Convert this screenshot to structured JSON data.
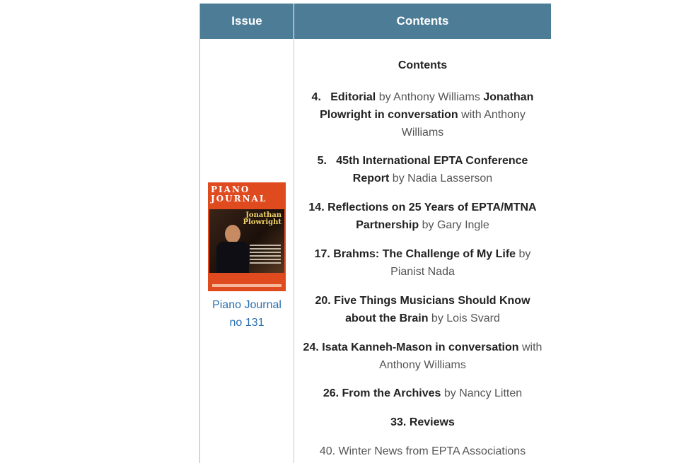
{
  "table": {
    "header_issue": "Issue",
    "header_contents": "Contents"
  },
  "issue": {
    "cover_title_line1": "PIANO",
    "cover_title_line2": "JOURNAL",
    "cover_logo": "epta",
    "cover_name_line1": "Jonathan",
    "cover_name_line2": "Plowright",
    "link_line1": "Piano Journal",
    "link_line2": "no 131"
  },
  "contents": {
    "heading": "Contents",
    "entries": [
      {
        "num": "4.",
        "title": "Editorial",
        "by": " by Anthony Williams ",
        "title2": "Jonathan Plowright in conversation",
        "by2": " with Anthony Williams"
      },
      {
        "num": "5.",
        "title": "45th International EPTA Conference Report",
        "by": " by Nadia Lasserson"
      },
      {
        "num": "14.",
        "title": "Reflections on 25 Years of EPTA/MTNA Partnership",
        "by": " by Gary Ingle"
      },
      {
        "num": "17.",
        "title": "Brahms: The Challenge of My Life",
        "by": " by Pianist Nada"
      },
      {
        "num": "20.",
        "title": "Five Things Musicians Should Know about the Brain",
        "by": " by Lois Svard"
      },
      {
        "num": "24.",
        "title": "Isata Kanneh-Mason in conversation",
        "by": " with Anthony Williams"
      },
      {
        "num": "26.",
        "title": "From the Archives",
        "by": " by Nancy Litten"
      },
      {
        "num": "33.",
        "title": "Reviews",
        "by": ""
      },
      {
        "num": "40.",
        "title": "",
        "by": "Winter News from EPTA Associations"
      }
    ]
  }
}
